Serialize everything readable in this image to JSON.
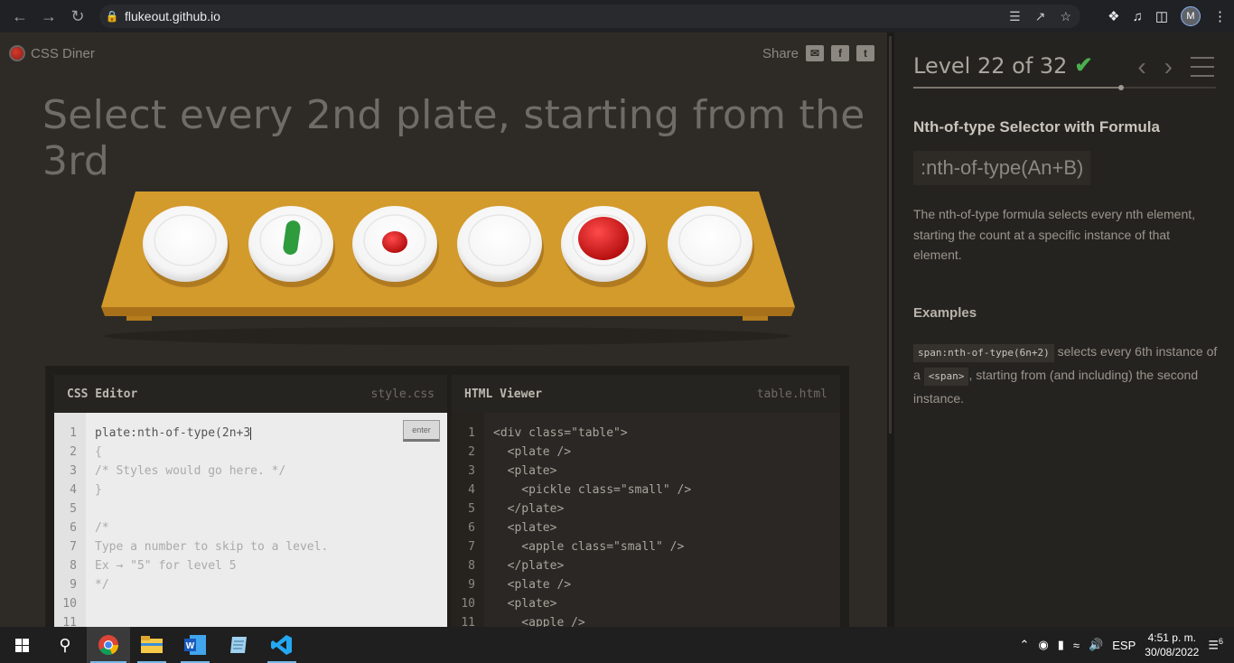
{
  "browser": {
    "url": "flukeout.github.io",
    "profile_initial": "M"
  },
  "header": {
    "logo_text": "CSS Diner",
    "share_label": "Share"
  },
  "instruction": "Select every 2nd plate, starting from the 3rd",
  "table": {
    "plates": [
      {
        "item": "none"
      },
      {
        "item": "pickle-small"
      },
      {
        "item": "apple-small"
      },
      {
        "item": "none"
      },
      {
        "item": "apple"
      },
      {
        "item": "none"
      }
    ]
  },
  "css_editor": {
    "title": "CSS Editor",
    "filename": "style.css",
    "enter_label": "enter",
    "input_value": "plate:nth-of-type(2n+3",
    "line_numbers": [
      "1",
      "2",
      "3",
      "4",
      "5",
      "6",
      "7",
      "8",
      "9",
      "10",
      "11"
    ],
    "lines": [
      "{",
      "/* Styles would go here. */",
      "}",
      "",
      "/*",
      "Type a number to skip to a level.",
      "Ex → \"5\" for level 5",
      "*/",
      "",
      ""
    ]
  },
  "html_viewer": {
    "title": "HTML Viewer",
    "filename": "table.html",
    "line_numbers": [
      "1",
      "2",
      "3",
      "4",
      "5",
      "6",
      "7",
      "8",
      "9",
      "10",
      "11"
    ],
    "lines": [
      "<div class=\"table\">",
      "  <plate />",
      "  <plate>",
      "    <pickle class=\"small\" />",
      "  </plate>",
      "  <plate>",
      "    <apple class=\"small\" />",
      "  </plate>",
      "  <plate />",
      "  <plate>",
      "    <apple />"
    ]
  },
  "sidebar": {
    "level_text": "Level 22 of 32",
    "progress": 0.6875,
    "selector_name": "Nth-of-type Selector with Formula",
    "syntax": ":nth-of-type(An+B)",
    "hint": "The nth-of-type formula selects every nth element, starting the count at a specific instance of that element.",
    "examples_title": "Examples",
    "example_code_1": "span:nth-of-type(6n+2)",
    "example_text_1": " selects every 6th instance of a ",
    "example_code_2": "<span>",
    "example_text_2": ", starting from (and including) the second instance."
  },
  "taskbar": {
    "language": "ESP",
    "time": "4:51 p. m.",
    "date": "30/08/2022",
    "notification_count": "6"
  },
  "colors": {
    "check": "#4caf50",
    "table": "#d39a2c",
    "apple": "#d61f1f",
    "pickle": "#2e9b3d"
  }
}
